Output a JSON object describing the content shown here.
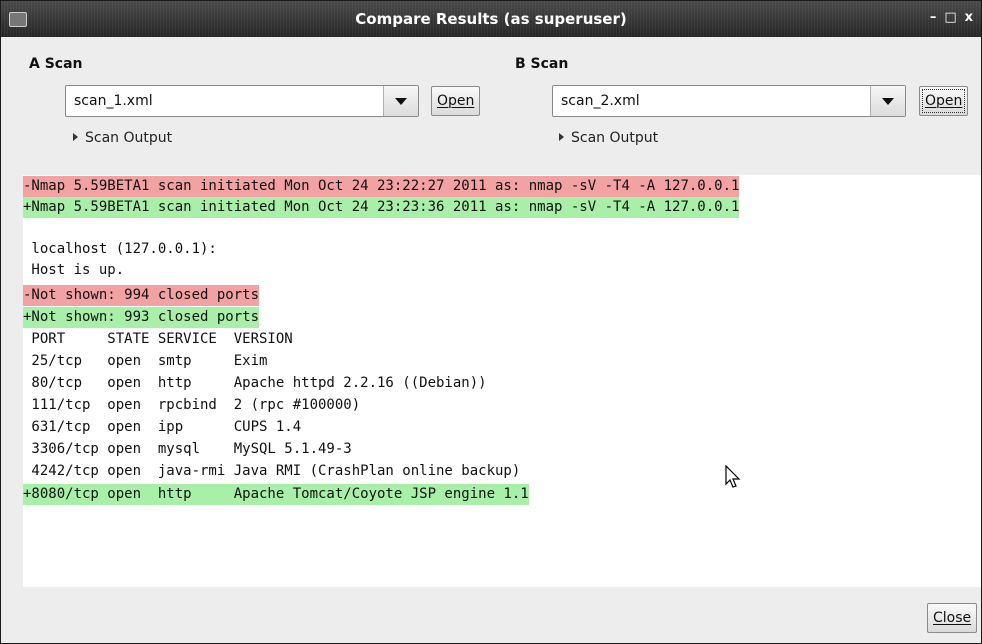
{
  "window": {
    "title": "Compare Results (as superuser)",
    "controls": [
      "–",
      "□",
      "x"
    ]
  },
  "scan_a": {
    "label": "A Scan",
    "file": "scan_1.xml",
    "open_label": "Open",
    "expander_label": "Scan Output"
  },
  "scan_b": {
    "label": "B Scan",
    "file": "scan_2.xml",
    "open_label": "Open",
    "expander_label": "Scan Output"
  },
  "diff_lines": [
    {
      "type": "del",
      "text": "-Nmap 5.59BETA1 scan initiated Mon Oct 24 23:22:27 2011 as: nmap -sV -T4 -A 127.0.0.1"
    },
    {
      "type": "add",
      "text": "+Nmap 5.59BETA1 scan initiated Mon Oct 24 23:23:36 2011 as: nmap -sV -T4 -A 127.0.0.1"
    },
    {
      "type": "ctx",
      "text": ""
    },
    {
      "type": "ctx",
      "text": " localhost (127.0.0.1):"
    },
    {
      "type": "ctx",
      "text": " Host is up."
    },
    {
      "type": "del",
      "text": "-Not shown: 994 closed ports"
    },
    {
      "type": "add",
      "text": "+Not shown: 993 closed ports"
    },
    {
      "type": "ctx",
      "text": " PORT     STATE SERVICE  VERSION"
    },
    {
      "type": "ctx",
      "text": " 25/tcp   open  smtp     Exim"
    },
    {
      "type": "ctx",
      "text": " 80/tcp   open  http     Apache httpd 2.2.16 ((Debian))"
    },
    {
      "type": "ctx",
      "text": " 111/tcp  open  rpcbind  2 (rpc #100000)"
    },
    {
      "type": "ctx",
      "text": " 631/tcp  open  ipp      CUPS 1.4"
    },
    {
      "type": "ctx",
      "text": " 3306/tcp open  mysql    MySQL 5.1.49-3"
    },
    {
      "type": "ctx",
      "text": " 4242/tcp open  java-rmi Java RMI (CrashPlan online backup)"
    },
    {
      "type": "add",
      "text": "+8080/tcp open  http     Apache Tomcat/Coyote JSP engine 1.1"
    }
  ],
  "close_label": "Close",
  "colors": {
    "removed": "#f2a2a2",
    "added": "#a8f0a8"
  }
}
